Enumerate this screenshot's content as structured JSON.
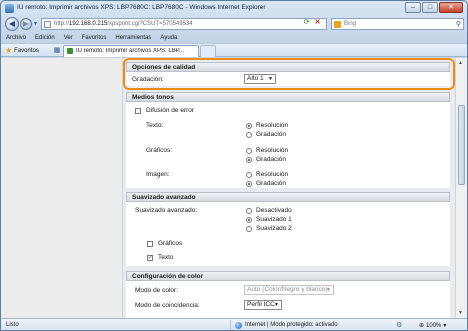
{
  "window": {
    "title": "IU remoto: Imprimir archivos XPS: LBP7680C: LBP7680C - Windows Internet Explorer",
    "minimize": "–",
    "maximize": "□",
    "close": "✕"
  },
  "address": {
    "url_prefix": "http://",
    "url_host": "192.168.0.215",
    "url_path": "/xpsprint.cgi?CSUT=570549534",
    "search_placeholder": "Bing"
  },
  "menu": [
    "Archivo",
    "Edición",
    "Ver",
    "Favoritos",
    "Herramientas",
    "Ayuda"
  ],
  "favorites": {
    "label": "Favoritos",
    "tab_label": "IU remoto: Imprimir archivos XPS: LBP..."
  },
  "quality": {
    "header": "Opciones de calidad",
    "gradation_label": "Gradación:",
    "gradation_value": "Alto 1"
  },
  "halftones": {
    "header": "Medios tonos",
    "error_diffusion_label": "Difusión de error",
    "error_diffusion_checked": false,
    "text_label": "Texto:",
    "graphics_label": "Gráficos:",
    "image_label": "Imagen:",
    "opt_resolution": "Resolución",
    "opt_gradation": "Gradación",
    "text_selected": "Resolución",
    "graphics_selected": "Gradación",
    "image_selected": "Gradación"
  },
  "smoothing": {
    "header": "Suavizado avanzado",
    "label": "Suavizado avanzado:",
    "opt_off": "Desactivado",
    "opt_1": "Suavizado 1",
    "opt_2": "Suavizado 2",
    "selected": "Suavizado 1",
    "graphics_label": "Gráficos",
    "graphics_checked": false,
    "text_label": "Texto",
    "text_checked": true
  },
  "color": {
    "header": "Configuración de color",
    "mode_label": "Modo de color:",
    "mode_value": "Auto (Color/Negro y blanco)",
    "match_label": "Modo de coincidencia:",
    "match_value": "Perfil ICC"
  },
  "status": {
    "text": "Listo",
    "zone": "Internet | Modo protegido: activado",
    "zoom": "100%"
  },
  "colors": {
    "highlight": "#f08a12"
  }
}
